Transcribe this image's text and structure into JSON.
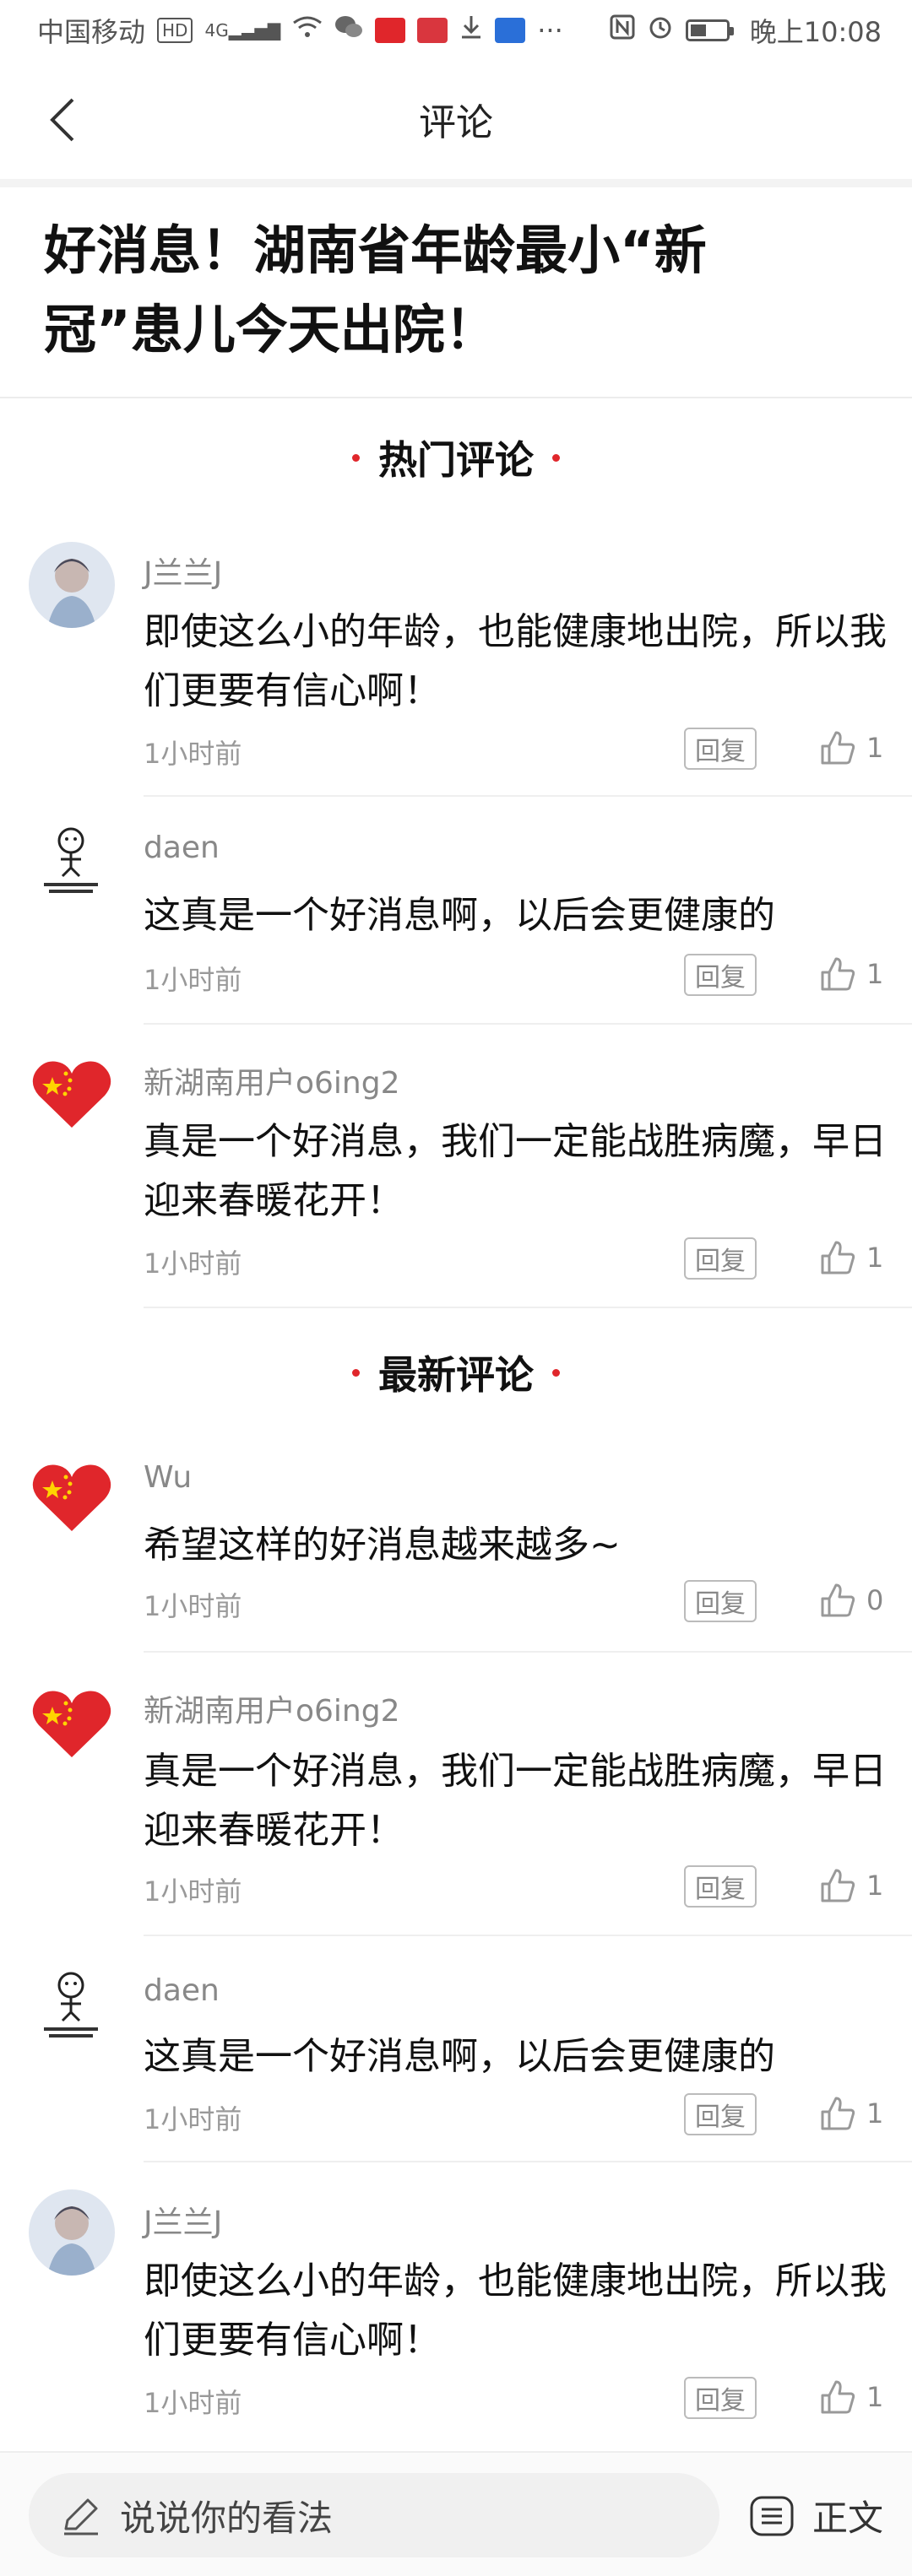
{
  "status_bar": {
    "carrier": "中国移动",
    "hd": "HD",
    "network": "4G",
    "time": "晚上10:08"
  },
  "nav": {
    "title": "评论"
  },
  "article": {
    "title": "好消息！湖南省年龄最小“新冠”患儿今天出院！"
  },
  "sections": {
    "hot": "热门评论",
    "latest": "最新评论"
  },
  "labels": {
    "reply": "回复"
  },
  "hot_comments": [
    {
      "user": "J兰兰J",
      "avatar": "photo-avatar",
      "text": "即使这么小的年龄，也能健康地出院，所以我们更要有信心啊！",
      "time": "1小时前",
      "likes": "1"
    },
    {
      "user": "daen",
      "avatar": "sketch-avatar",
      "text": "这真是一个好消息啊，以后会更健康的",
      "time": "1小时前",
      "likes": "1"
    },
    {
      "user": "新湖南用户o6ing2",
      "avatar": "flag-heart-avatar",
      "text": "真是一个好消息，我们一定能战胜病魔，早日迎来春暖花开！",
      "time": "1小时前",
      "likes": "1"
    }
  ],
  "latest_comments": [
    {
      "user": "Wu",
      "avatar": "flag-heart-avatar",
      "text": "希望这样的好消息越来越多~",
      "time": "1小时前",
      "likes": "0"
    },
    {
      "user": "新湖南用户o6ing2",
      "avatar": "flag-heart-avatar",
      "text": "真是一个好消息，我们一定能战胜病魔，早日迎来春暖花开！",
      "time": "1小时前",
      "likes": "1"
    },
    {
      "user": "daen",
      "avatar": "sketch-avatar",
      "text": "这真是一个好消息啊，以后会更健康的",
      "time": "1小时前",
      "likes": "1"
    },
    {
      "user": "J兰兰J",
      "avatar": "photo-avatar",
      "text": "即使这么小的年龄，也能健康地出院，所以我们更要有信心啊！",
      "time": "1小时前",
      "likes": "1"
    }
  ],
  "bottom_bar": {
    "input_placeholder": "说说你的看法",
    "body_label": "正文"
  },
  "colors": {
    "accent": "#e0262b",
    "muted": "#888888"
  }
}
